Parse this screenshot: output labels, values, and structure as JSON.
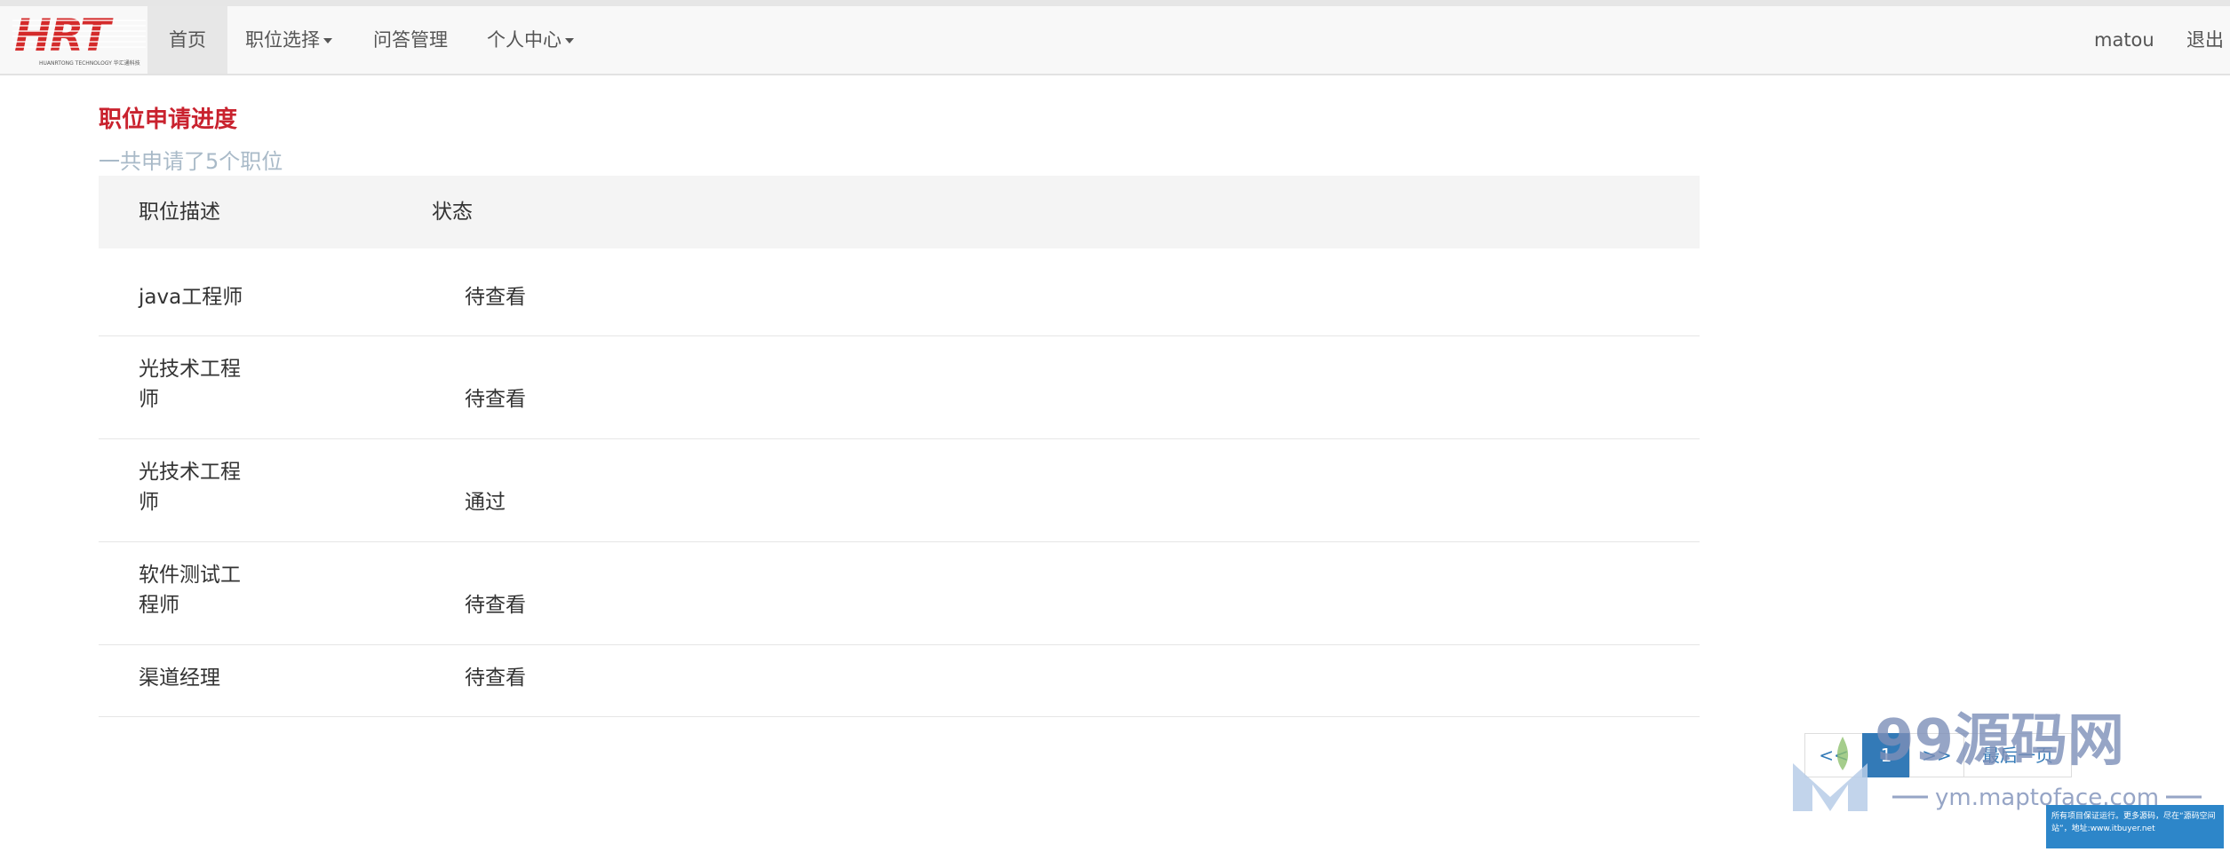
{
  "logo": {
    "text": "HRT",
    "tagline": "HUANRTONG TECHNOLOGY 华汇通科技"
  },
  "nav": {
    "home": "首页",
    "jobs": "职位选择",
    "qa": "问答管理",
    "personal": "个人中心",
    "user": "matou",
    "logout": "退出"
  },
  "page": {
    "title": "职位申请进度",
    "subtitle": "一共申请了5个职位"
  },
  "table": {
    "headers": [
      "职位描述",
      "状态"
    ],
    "rows": [
      {
        "position": "java工程师",
        "status": "待查看"
      },
      {
        "position": "光技术工程师",
        "status": "待查看"
      },
      {
        "position": "光技术工程师",
        "status": "通过"
      },
      {
        "position": "软件测试工程师",
        "status": "待查看"
      },
      {
        "position": "渠道经理",
        "status": "待查看"
      }
    ]
  },
  "pagination": {
    "prev": "<<",
    "current": "1",
    "next": ">>",
    "last": "最后一页"
  },
  "watermark": {
    "brand": "99源码网",
    "url": "ym.maptoface.com",
    "note": "所有项目保证运行。更多源码，尽在“源码空间站”，地址:www.itbuyer.net"
  },
  "colors": {
    "title_red": "#c9222e",
    "subtitle_gray": "#a9bac8",
    "link_blue": "#337ab7",
    "nav_bg": "#f8f8f8"
  }
}
